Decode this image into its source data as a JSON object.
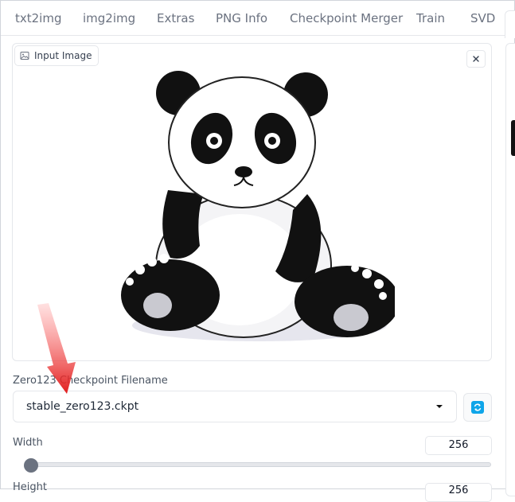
{
  "tabs": [
    {
      "label": "txt2img"
    },
    {
      "label": "img2img"
    },
    {
      "label": "Extras"
    },
    {
      "label": "PNG Info"
    },
    {
      "label": "Checkpoint Merger"
    },
    {
      "label": "Train"
    },
    {
      "label": "SVD"
    }
  ],
  "input_image": {
    "label": "Input Image",
    "close_icon": "close-icon"
  },
  "checkpoint": {
    "label": "Zero123 Checkpoint Filename",
    "value": "stable_zero123.ckpt",
    "refresh_icon": "refresh-icon"
  },
  "width": {
    "label": "Width",
    "value": "256",
    "fraction": 0.02
  },
  "height": {
    "label": "Height",
    "value": "256"
  },
  "colors": {
    "accent": "#0ea5e9",
    "arrow": "#e11d1d"
  }
}
